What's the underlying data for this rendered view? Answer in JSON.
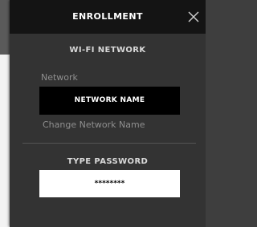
{
  "panel": {
    "title": "ENROLLMENT",
    "close_icon": "close-icon"
  },
  "wifi": {
    "section_title": "WI-FI NETWORK",
    "network_label": "Network",
    "network_value": "NETWORK NAME",
    "change_link": "Change Network Name"
  },
  "password": {
    "section_title": "TYPE PASSWORD",
    "value": "********"
  },
  "colors": {
    "header_bg": "#141414",
    "panel_bg": "#333333",
    "network_field_bg": "#000000",
    "password_field_bg": "#ffffff"
  }
}
